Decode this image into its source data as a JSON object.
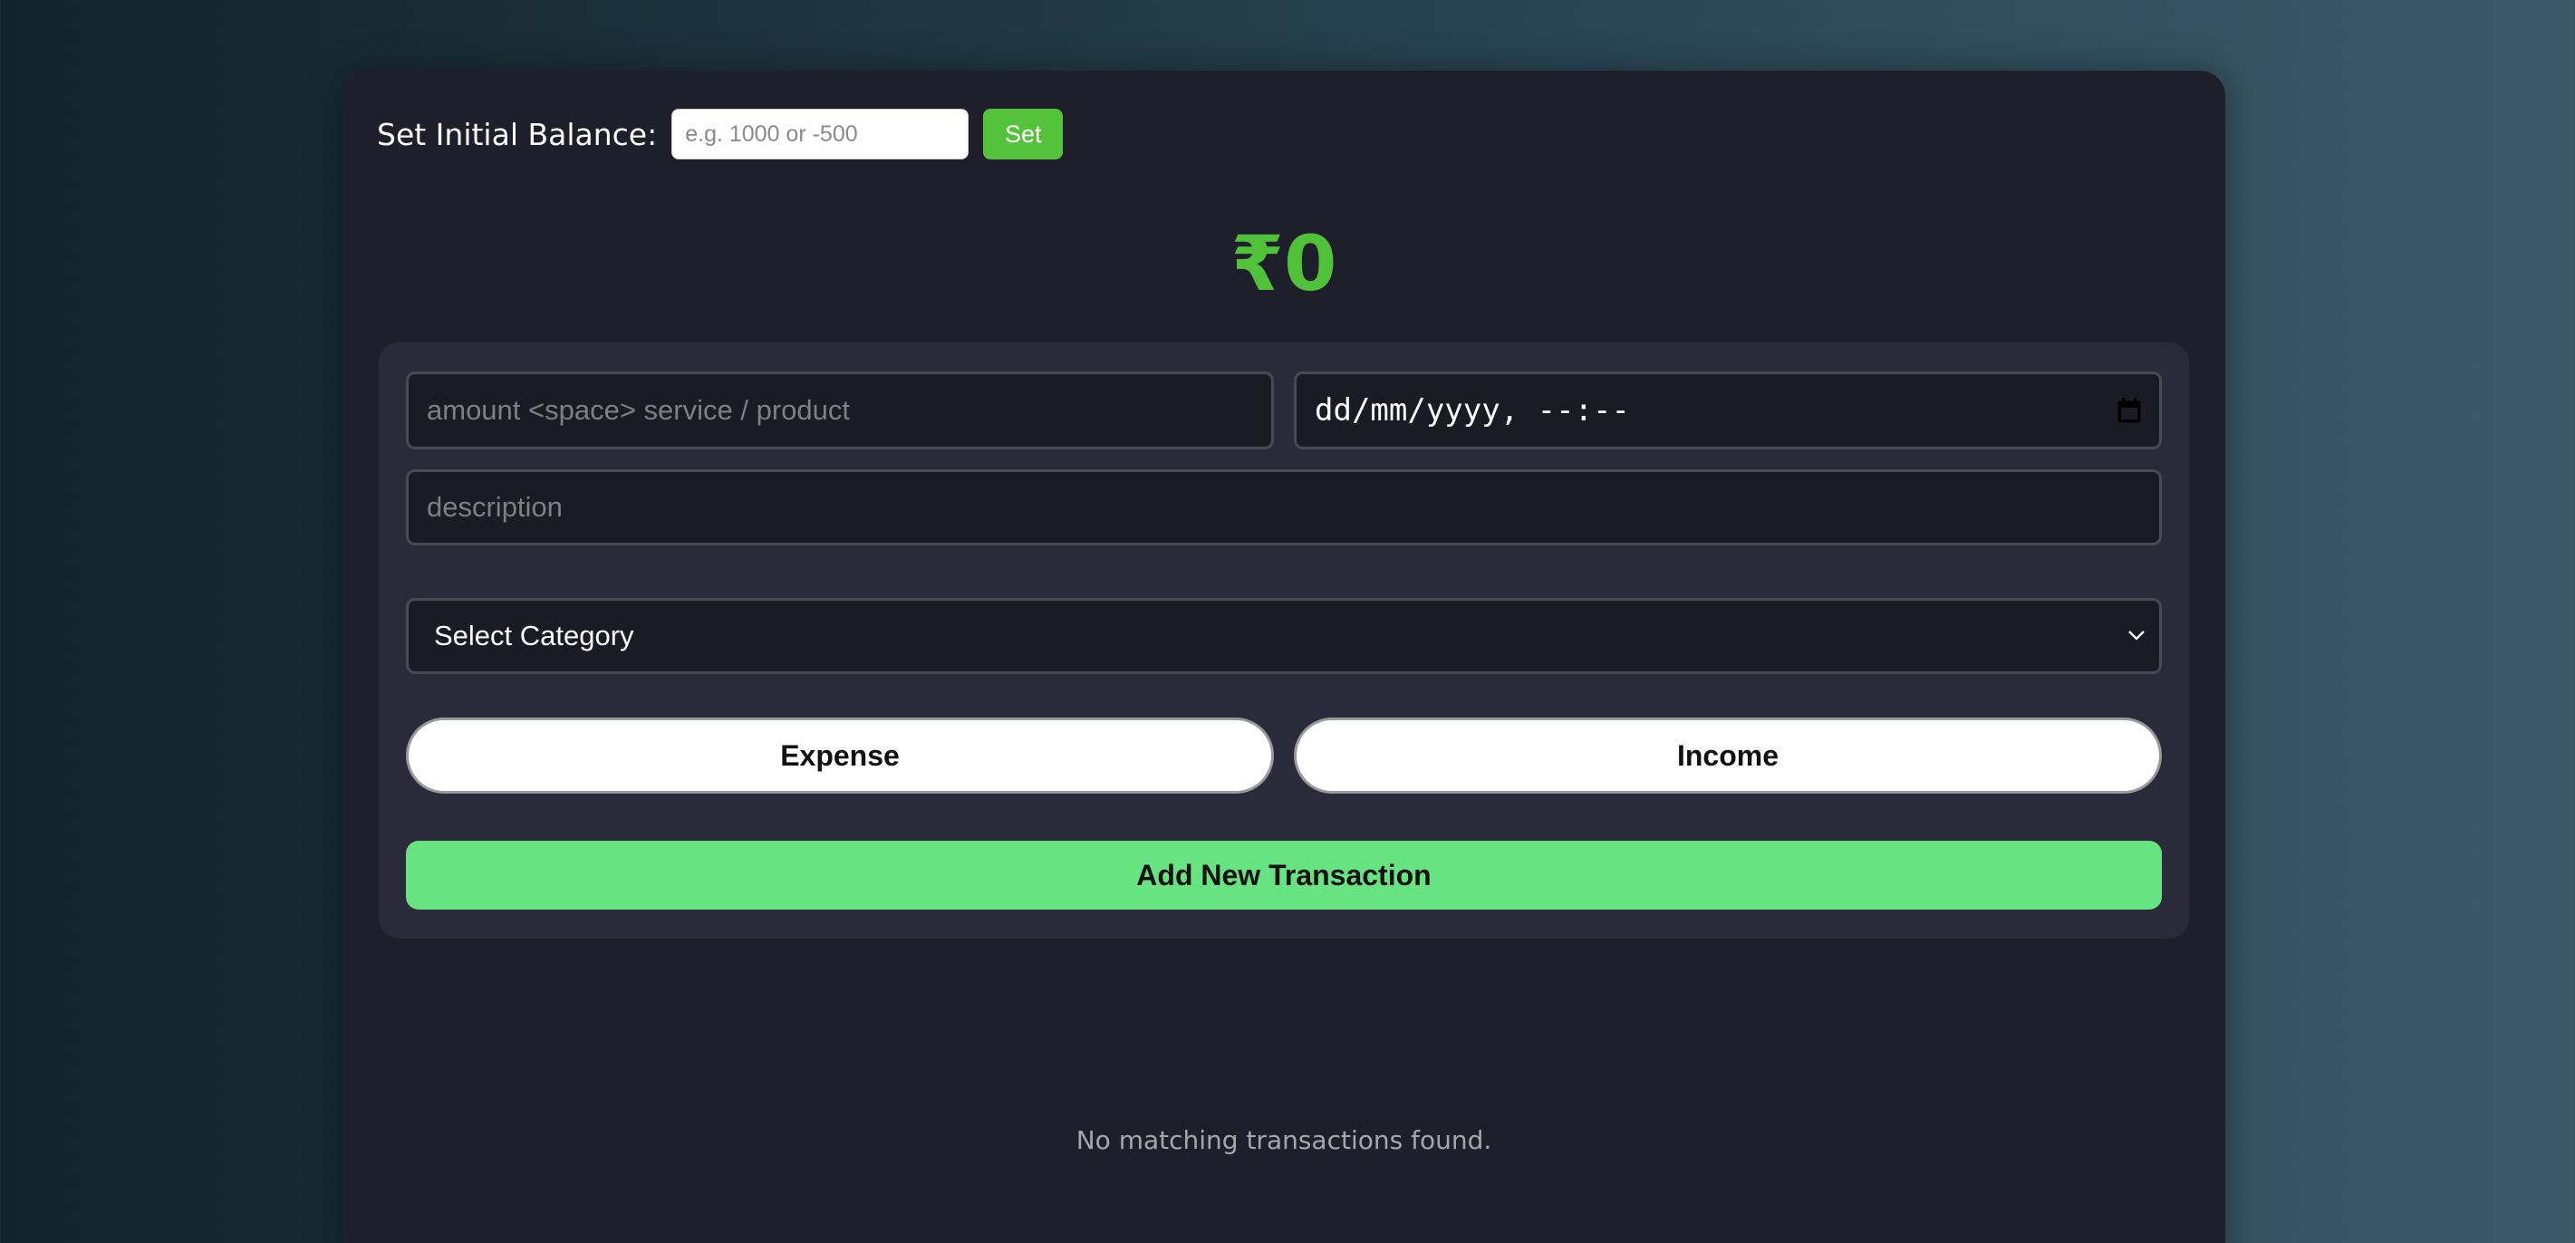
{
  "balance_setter": {
    "label": "Set Initial Balance:",
    "input_placeholder": "e.g. 1000 or -500",
    "input_value": "",
    "button_label": "Set"
  },
  "balance": {
    "display": "₹0",
    "color": "#4fc23a"
  },
  "form": {
    "amount_placeholder": "amount <space> service / product",
    "amount_value": "",
    "date_display": "dd/mm/yyyy, --:--",
    "date_icon": "calendar-icon",
    "description_placeholder": "description",
    "description_value": "",
    "category_selected": "Select Category",
    "category_icon": "chevron-down-icon",
    "expense_label": "Expense",
    "income_label": "Income",
    "add_button_label": "Add New Transaction",
    "add_button_color": "#68e381"
  },
  "transactions": {
    "empty_message": "No matching transactions found."
  }
}
